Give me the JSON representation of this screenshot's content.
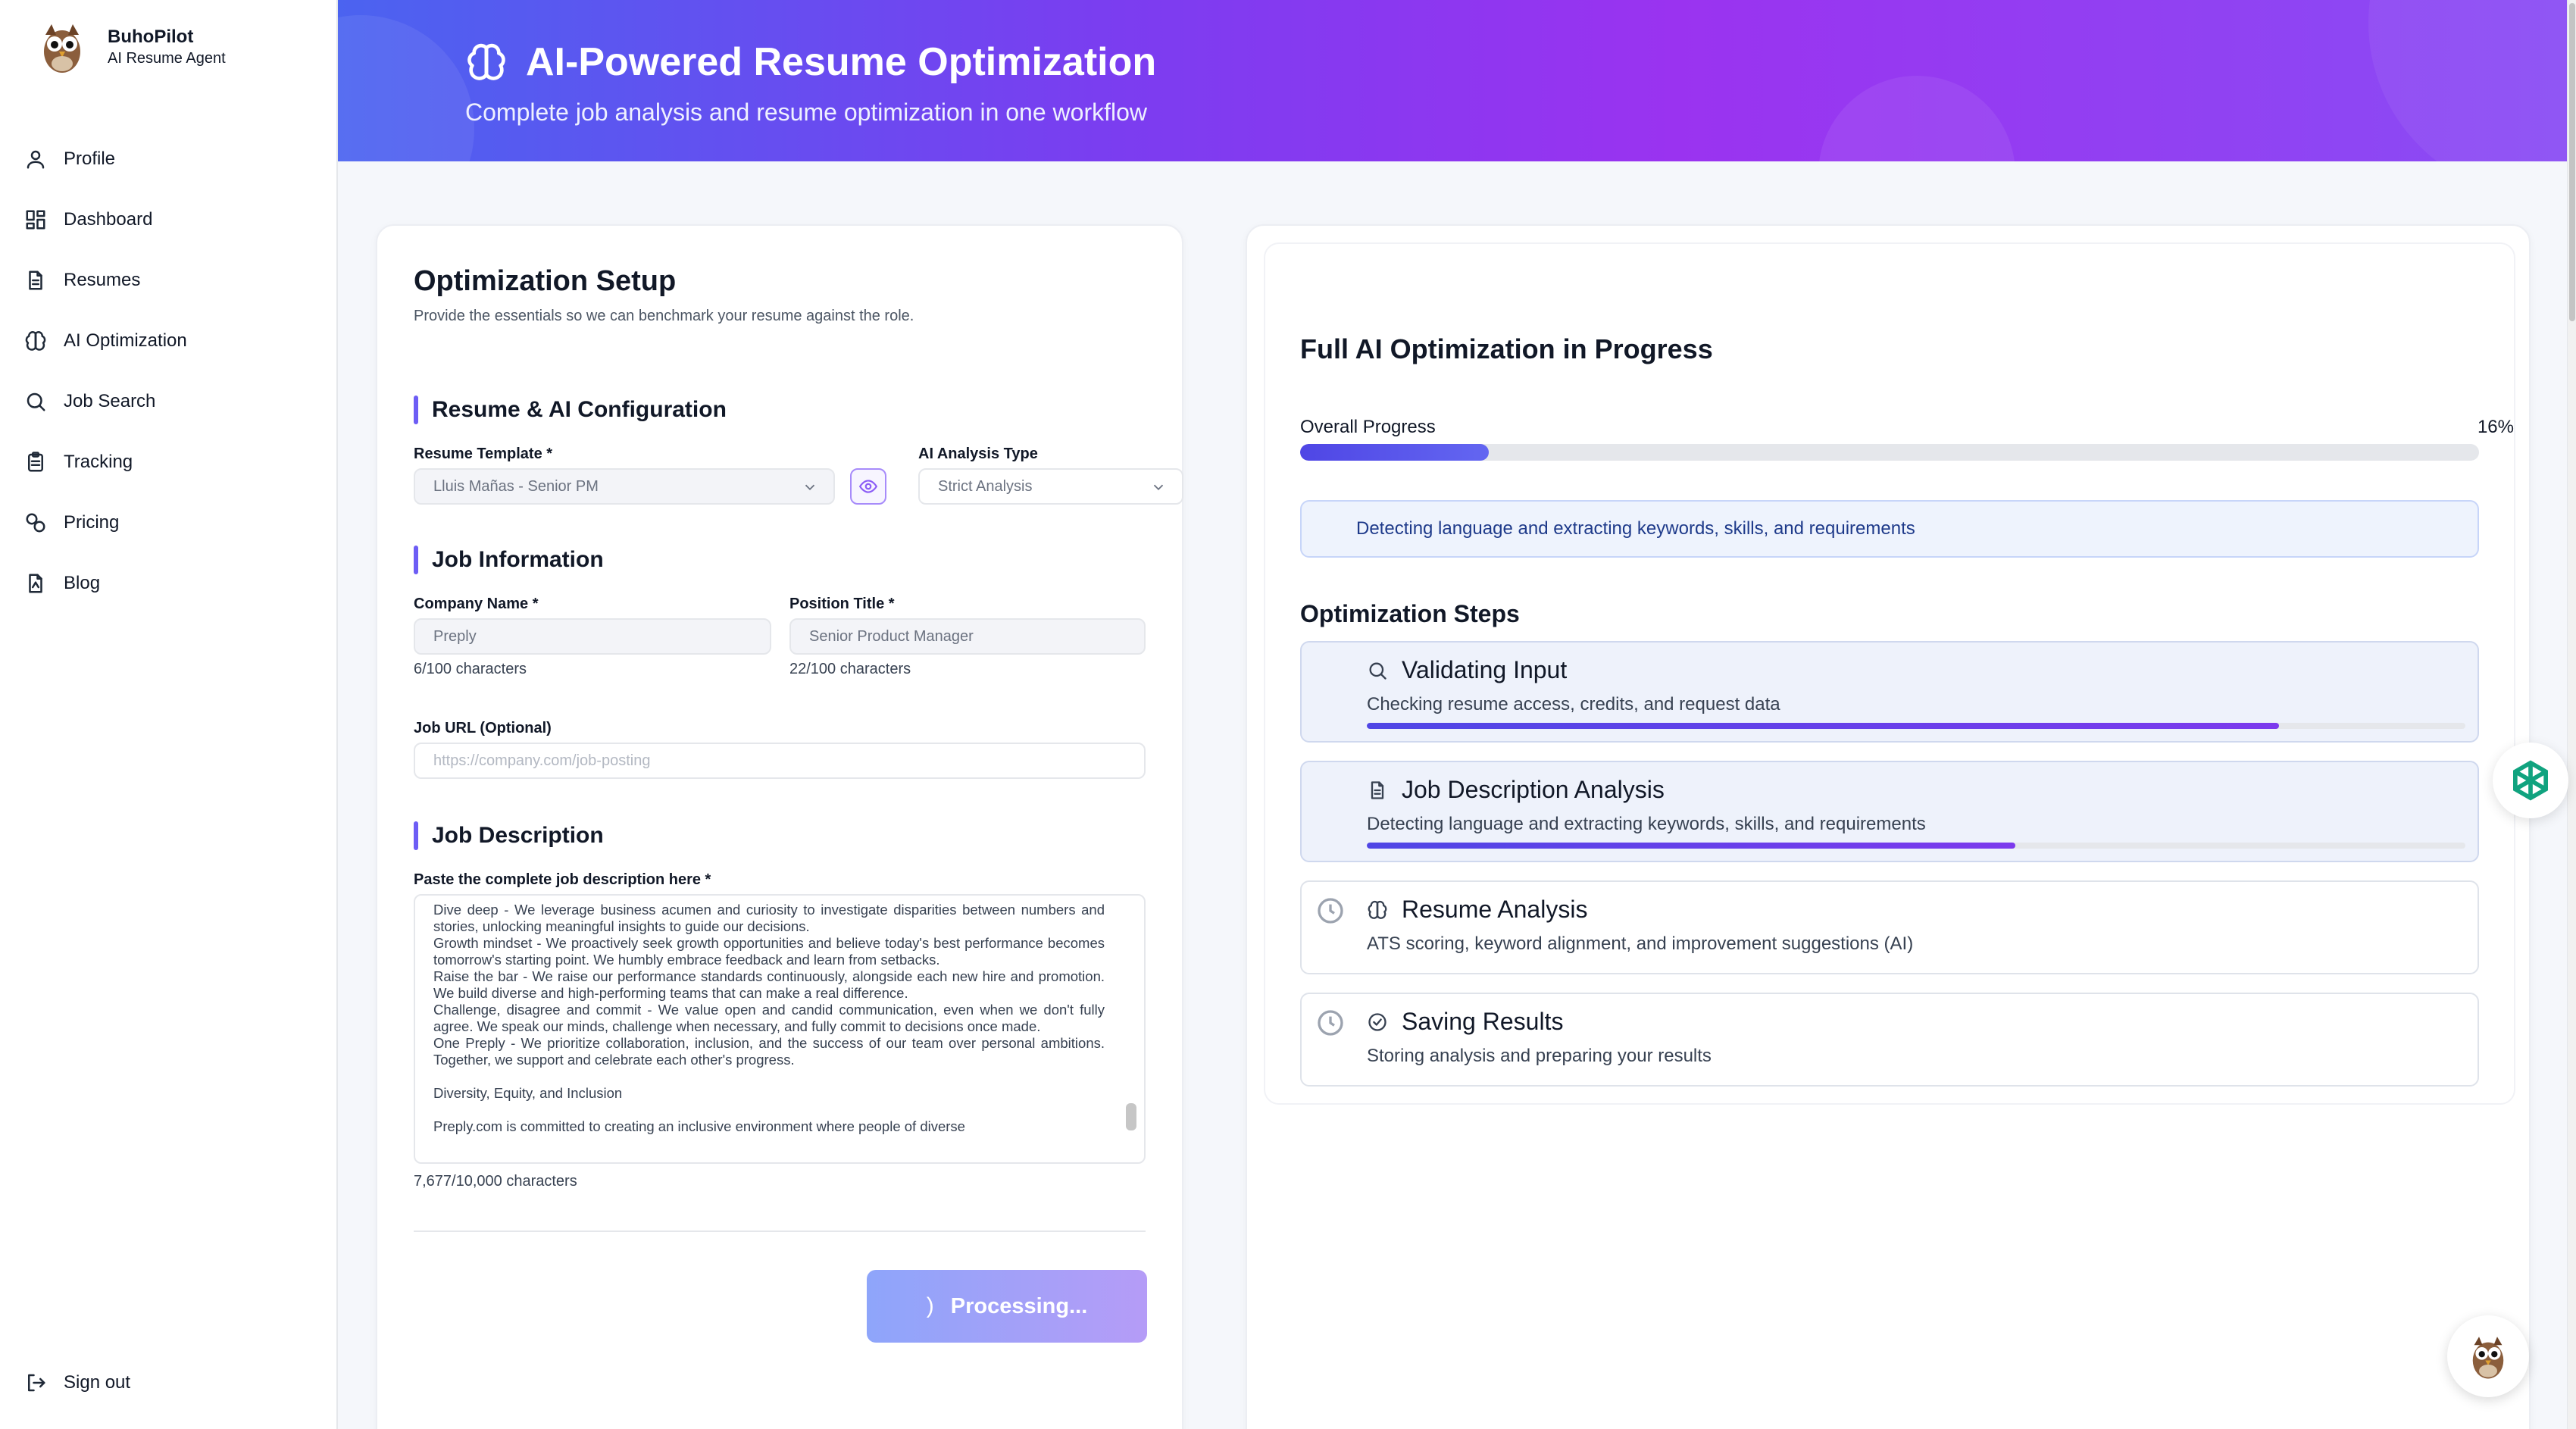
{
  "brand": {
    "name": "BuhoPilot",
    "subtitle": "AI Resume Agent",
    "logo_icon": "owl-logo-icon"
  },
  "sidebar": {
    "items": [
      {
        "label": "Profile",
        "icon": "user-icon"
      },
      {
        "label": "Dashboard",
        "icon": "dashboard-icon"
      },
      {
        "label": "Resumes",
        "icon": "document-icon"
      },
      {
        "label": "AI Optimization",
        "icon": "brain-icon"
      },
      {
        "label": "Job Search",
        "icon": "search-icon"
      },
      {
        "label": "Tracking",
        "icon": "clipboard-icon"
      },
      {
        "label": "Pricing",
        "icon": "coins-icon"
      },
      {
        "label": "Blog",
        "icon": "blog-icon"
      }
    ],
    "signout": "Sign out"
  },
  "header": {
    "title": "AI-Powered Resume Optimization",
    "subtitle": "Complete job analysis and resume optimization in one workflow",
    "colors": {
      "gradient_start": "#4b63f0",
      "gradient_mid": "#9a33f0"
    }
  },
  "setup": {
    "title": "Optimization Setup",
    "description": "Provide the essentials so we can benchmark your resume against the role.",
    "resume_section": {
      "title": "Resume & AI Configuration",
      "template_label": "Resume Template *",
      "template_value": "Lluis Mañas - Senior PM",
      "analysis_label": "AI Analysis Type",
      "analysis_value": "Strict Analysis"
    },
    "job_section": {
      "title": "Job Information",
      "company_label": "Company Name *",
      "company_value": "Preply",
      "company_count": "6/100 characters",
      "position_label": "Position Title *",
      "position_value": "Senior Product Manager",
      "position_count": "22/100 characters",
      "url_label": "Job URL (Optional)",
      "url_placeholder": "https://company.com/job-posting"
    },
    "description_section": {
      "title": "Job Description",
      "label": "Paste the complete job description here *",
      "lines": [
        "Dive deep - We leverage business acumen and curiosity to investigate disparities between numbers and stories, unlocking meaningful insights to guide our decisions.",
        "Growth mindset - We proactively seek growth opportunities and believe today's best performance becomes tomorrow's starting point. We humbly embrace feedback and learn from setbacks.",
        "Raise the bar - We raise our performance standards continuously, alongside each new hire and promotion. We build diverse and high-performing teams that can make a real difference.",
        "Challenge, disagree and commit - We value open and candid communication, even when we don't fully agree. We speak our minds, challenge when necessary, and fully commit to decisions once made.",
        "One Preply - We prioritize collaboration, inclusion, and the success of our team over personal ambitions. Together, we support and celebrate each other's progress.",
        "",
        "Diversity, Equity, and Inclusion",
        "",
        "Preply.com is committed to creating an inclusive environment where people of diverse"
      ],
      "count": "7,677/10,000 characters"
    },
    "button_label": "Processing..."
  },
  "progress": {
    "title": "Full AI Optimization in Progress",
    "overall_label": "Overall Progress",
    "overall_percent_text": "16%",
    "overall_value": 0.16,
    "status_message": "Detecting language and extracting keywords, skills, and requirements",
    "steps_title": "Optimization Steps",
    "steps": [
      {
        "title": "Validating Input",
        "description": "Checking resume access, credits, and request data",
        "icon": "search-icon",
        "state": "active",
        "progress": 0.83
      },
      {
        "title": "Job Description Analysis",
        "description": "Detecting language and extracting keywords, skills, and requirements",
        "icon": "document-icon",
        "state": "active",
        "progress": 0.59
      },
      {
        "title": "Resume Analysis",
        "description": "ATS scoring, keyword alignment, and improvement suggestions (AI)",
        "icon": "brain-icon",
        "state": "pending"
      },
      {
        "title": "Saving Results",
        "description": "Storing analysis and preparing your results",
        "icon": "check-circle-icon",
        "state": "pending"
      }
    ]
  },
  "floating": {
    "assistant_icon": "openai-icon",
    "chat_icon": "owl-chat-icon"
  }
}
